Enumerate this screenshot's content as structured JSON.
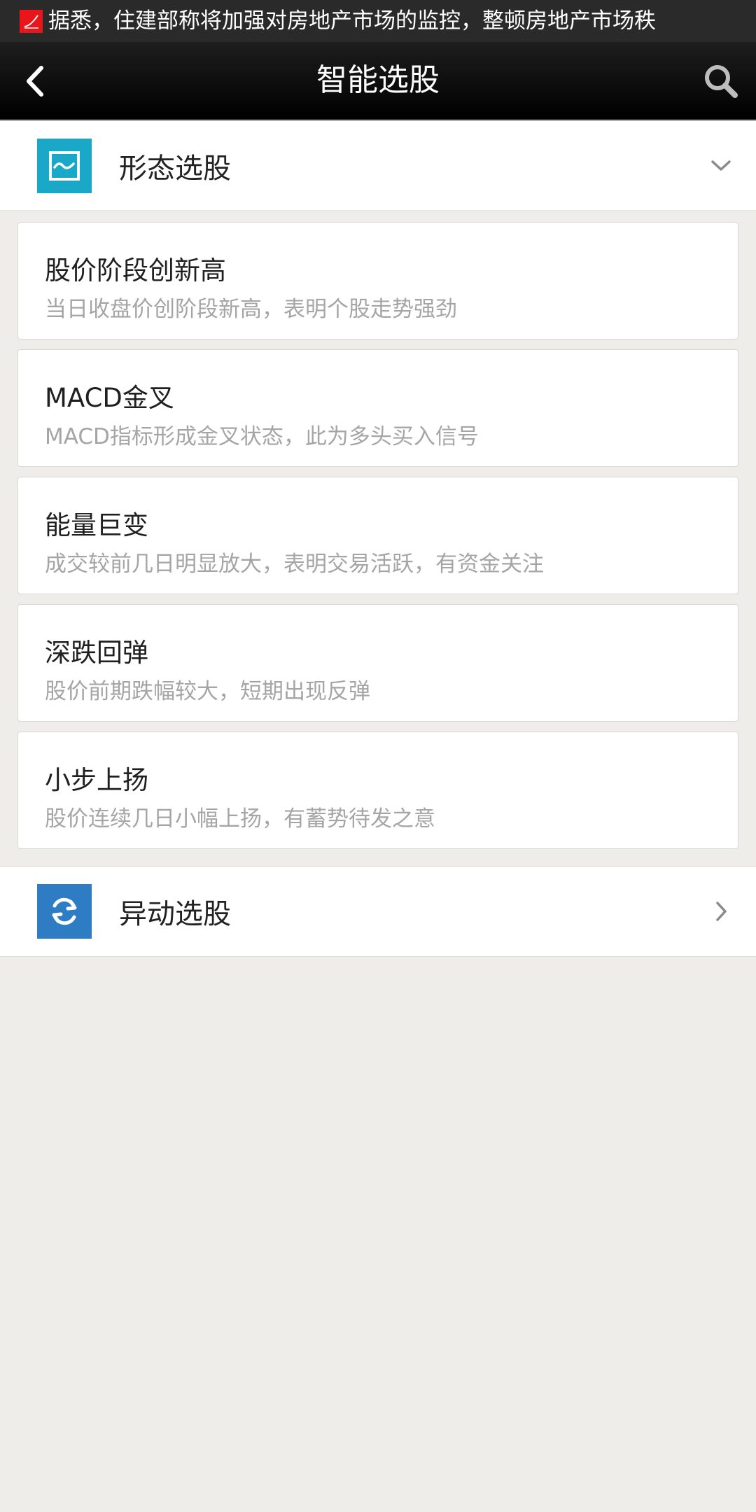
{
  "ticker": {
    "text": "据悉，住建部称将加强对房地产市场的监控，整顿房地产市场秩"
  },
  "navbar": {
    "title": "智能选股"
  },
  "sections": [
    {
      "label": "形态选股",
      "state": "expanded",
      "icon": "chart-wave-icon"
    },
    {
      "label": "异动选股",
      "state": "collapsed",
      "icon": "refresh-icon"
    }
  ],
  "items": [
    {
      "title": "股价阶段创新高",
      "desc": "当日收盘价创阶段新高，表明个股走势强劲"
    },
    {
      "title": "MACD金叉",
      "desc": "MACD指标形成金叉状态，此为多头买入信号"
    },
    {
      "title": "能量巨变",
      "desc": "成交较前几日明显放大，表明交易活跃，有资金关注"
    },
    {
      "title": "深跌回弹",
      "desc": "股价前期跌幅较大，短期出现反弹"
    },
    {
      "title": "小步上扬",
      "desc": "股价连续几日小幅上扬，有蓄势待发之意"
    }
  ],
  "colors": {
    "ticker_bg": "#2a2a2a",
    "logo_red": "#e8161b",
    "section1_icon": "#1aa8c9",
    "section2_icon": "#2e7dc4",
    "page_bg": "#efedea"
  }
}
